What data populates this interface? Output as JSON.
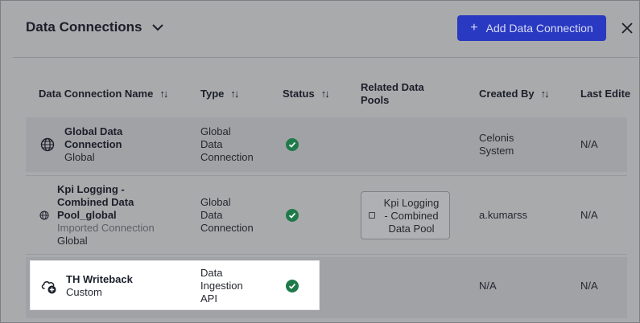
{
  "header": {
    "title": "Data Connections",
    "add_button_label": "Add Data Connection",
    "add_button_plus": "+"
  },
  "columns": {
    "name": "Data Connection Name",
    "type": "Type",
    "status": "Status",
    "pools_line1": "Related Data",
    "pools_line2": "Pools",
    "created_by": "Created By",
    "last_edited": "Last Edite",
    "sort_glyph": "↑↓"
  },
  "rows": [
    {
      "name_line1": "Global Data",
      "name_line2": "Connection",
      "subtitle": "Global",
      "type_line1": "Global",
      "type_line2": "Data",
      "type_line3": "Connection",
      "status": "success-check-icon",
      "created_line1": "Celonis",
      "created_line2": "System",
      "last_edited": "N/A",
      "icon": "globe-icon"
    },
    {
      "name_line1": "Kpi Logging -",
      "name_line2": "Combined Data",
      "name_line3": "Pool_global",
      "extra": "Imported Connection",
      "subtitle": "Global",
      "type_line1": "Global",
      "type_line2": "Data",
      "type_line3": "Connection",
      "status": "success-check-icon",
      "pool_line1": "Kpi Logging",
      "pool_line2": "- Combined",
      "pool_line3": "Data Pool",
      "created_by": "a.kumarss",
      "last_edited": "N/A",
      "icon": "globe-icon"
    },
    {
      "name": "TH Writeback",
      "subtitle": "Custom",
      "type_line1": "Data",
      "type_line2": "Ingestion",
      "type_line3": "API",
      "status": "success-check-icon",
      "created_by": "N/A",
      "last_edited": "N/A",
      "icon": "cloud-add-icon"
    }
  ],
  "colors": {
    "overlay": "#a9aaac",
    "accent": "#2a39c2",
    "success": "#1f7a4a"
  }
}
